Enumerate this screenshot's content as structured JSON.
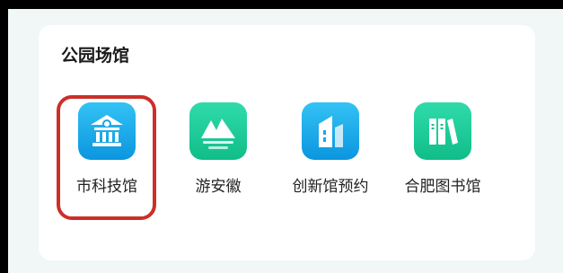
{
  "section": {
    "title": "公园场馆"
  },
  "tiles": [
    {
      "label": "市科技馆",
      "icon": "museum-icon",
      "color": "#12a9ea"
    },
    {
      "label": "游安徽",
      "icon": "mountain-icon",
      "color": "#1ccc98"
    },
    {
      "label": "创新馆预约",
      "icon": "building-icon",
      "color": "#12a9ea"
    },
    {
      "label": "合肥图书馆",
      "icon": "books-icon",
      "color": "#1ccc98"
    }
  ],
  "highlight": {
    "target": "市科技馆",
    "color": "#cc2f29"
  }
}
